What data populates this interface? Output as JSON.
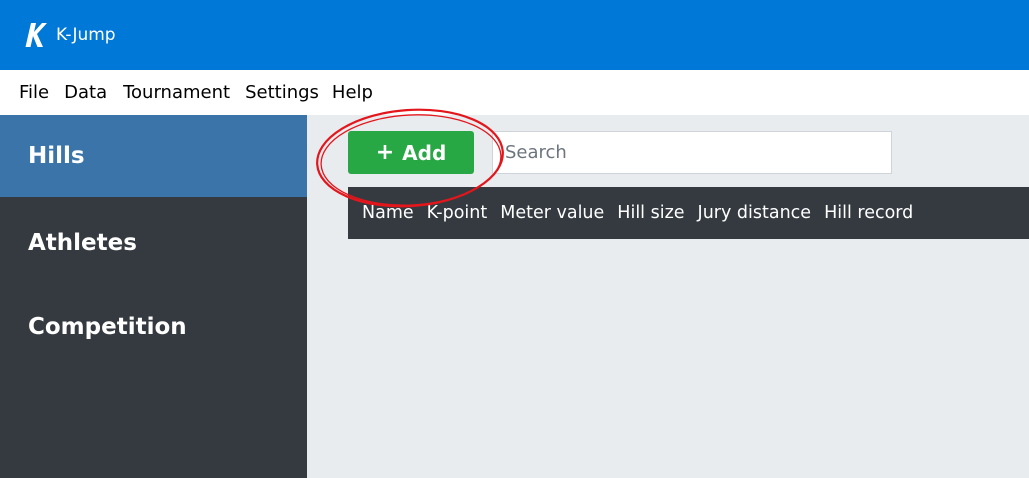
{
  "window": {
    "title": "K-Jump",
    "logo_letter": "K",
    "titlebar_color": "#0078d7"
  },
  "menu": {
    "items": [
      {
        "label": "File"
      },
      {
        "label": "Data"
      },
      {
        "label": "Tournament"
      },
      {
        "label": "Settings"
      },
      {
        "label": "Help"
      }
    ]
  },
  "sidebar": {
    "items": [
      {
        "label": "Hills",
        "active": true
      },
      {
        "label": "Athletes",
        "active": false
      },
      {
        "label": "Competition",
        "active": false
      }
    ],
    "active_color": "#3b74a8",
    "background_color": "#343a40"
  },
  "toolbar": {
    "add_icon": "plus-icon",
    "add_label": "Add",
    "add_color": "#28a745"
  },
  "search": {
    "value": "",
    "placeholder": "Search"
  },
  "table": {
    "columns": [
      "Name",
      "K-point",
      "Meter value",
      "Hill size",
      "Jury distance",
      "Hill record"
    ],
    "rows": []
  },
  "annotation": {
    "shape": "ellipse",
    "color": "#e3161c",
    "target": "add-button"
  }
}
